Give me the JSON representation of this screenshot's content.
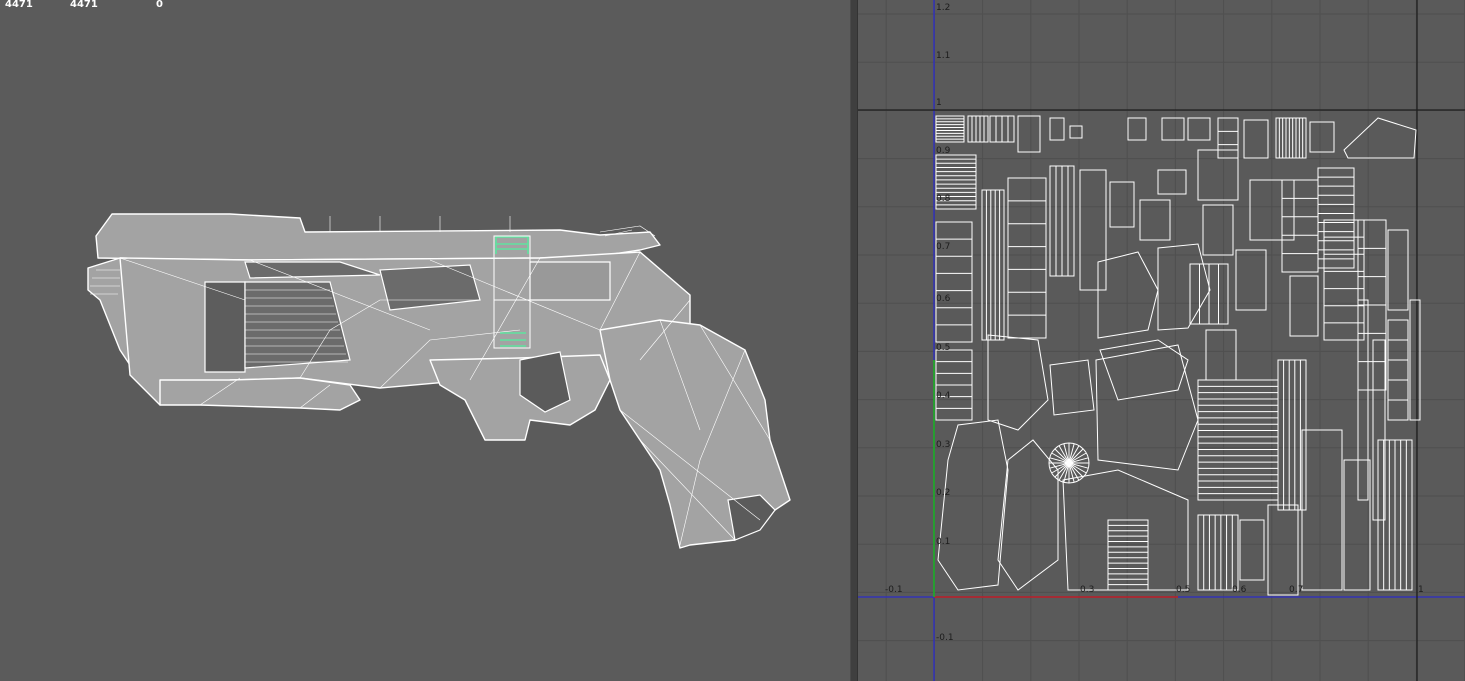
{
  "hud": {
    "verts": "4471",
    "faces": "4471",
    "selected": "0"
  },
  "uv_editor": {
    "v_labels": [
      "1.2",
      "1.1",
      "1",
      "0.9",
      "0.8",
      "0.7",
      "0.6",
      "0.5",
      "0.4",
      "0.3",
      "0.2",
      "0.1",
      "-0.1"
    ],
    "u_labels": [
      "-0.1",
      "0.3",
      "0.5",
      "0.6",
      "0.7",
      "1"
    ]
  },
  "colors": {
    "viewport_bg": "#5b5b5b",
    "wire": "#ffffff",
    "mesh_fill": "#a3a3a3",
    "selection_green": "#5fe3a0",
    "u_axis": "#c02020",
    "v_axis": "#1fb21f",
    "grid_axis": "#2c2cc8"
  }
}
